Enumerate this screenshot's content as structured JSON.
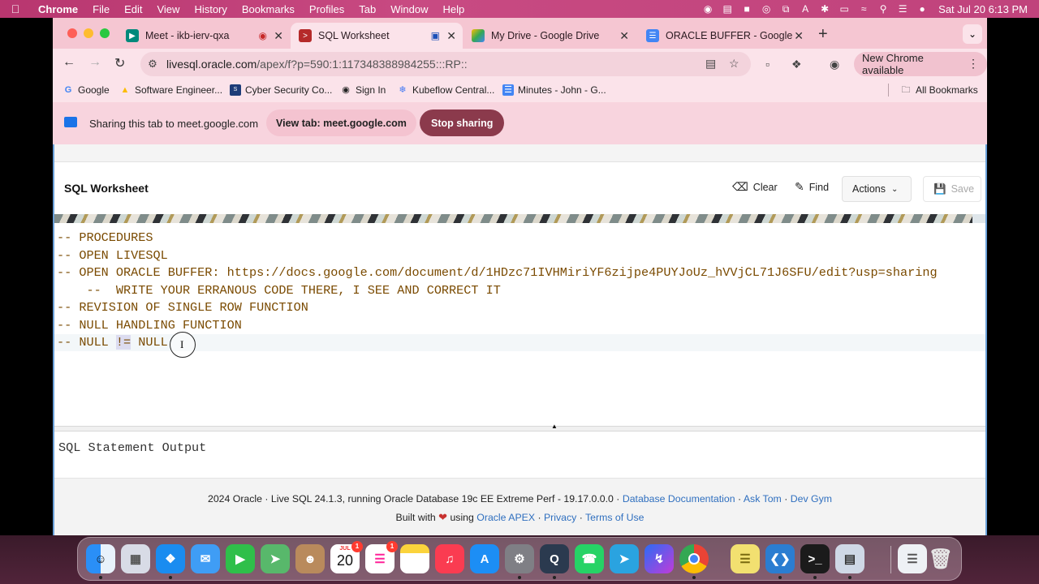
{
  "menubar": {
    "app": "Chrome",
    "items": [
      "File",
      "Edit",
      "View",
      "History",
      "Bookmarks",
      "Profiles",
      "Tab",
      "Window",
      "Help"
    ],
    "clock": "Sat Jul 20  6:13 PM"
  },
  "tabs": [
    {
      "title": "Meet - ikb-ierv-qxa",
      "favicon": "meet-icon"
    },
    {
      "title": "SQL Worksheet",
      "favicon": "terminal-icon"
    },
    {
      "title": "My Drive - Google Drive",
      "favicon": "drive-icon"
    },
    {
      "title": "ORACLE BUFFER - Google Do",
      "favicon": "docs-icon"
    }
  ],
  "address": {
    "host": "livesql.oracle.com",
    "path": "/apex/f?p=590:1:117348388984255:::RP::"
  },
  "new_chrome_label": "New Chrome available",
  "bookmarks": {
    "items": [
      "Google",
      "Software Engineer...",
      "Cyber Security Co...",
      "Sign In",
      "Kubeflow Central...",
      "Minutes - John - G..."
    ],
    "all_label": "All Bookmarks"
  },
  "sharebar": {
    "text": "Sharing this tab to meet.google.com",
    "view_tab": "View tab: meet.google.com",
    "stop": "Stop sharing"
  },
  "worksheet": {
    "title": "SQL Worksheet",
    "clear": "Clear",
    "find": "Find",
    "actions": "Actions",
    "save": "Save"
  },
  "editor": {
    "lines": [
      "-- PROCEDURES",
      "-- OPEN LIVESQL",
      "-- OPEN ORACLE BUFFER: https://docs.google.com/document/d/1HDzc71IVHMiriYF6zijpe4PUYJoUz_hVVjCL71J6SFU/edit?usp=sharing",
      "    --  WRITE YOUR ERRANOUS CODE THERE, I SEE AND CORRECT IT",
      "-- REVISION OF SINGLE ROW FUNCTION",
      "-- NULL HANDLING FUNCTION"
    ],
    "last_line": {
      "before": "-- NULL ",
      "highlight": "!=",
      "after": " NULL"
    }
  },
  "output": {
    "title": "SQL Statement Output"
  },
  "footer": {
    "line1_text": "2024 Oracle · Live SQL 24.1.3, running Oracle Database 19c EE Extreme Perf - 19.17.0.0.0 · ",
    "link_docs": "Database Documentation",
    "sep": " · ",
    "link_asktom": "Ask Tom",
    "link_devgym": "Dev Gym",
    "built_with": "Built with ",
    "using": " using ",
    "link_apex": "Oracle APEX",
    "link_privacy": "Privacy",
    "link_terms": "Terms of Use"
  },
  "dock": {
    "apps": [
      "finder-icon",
      "launchpad-icon",
      "safari-icon",
      "mail-icon",
      "facetime-icon",
      "maps-icon",
      "contacts-icon",
      "calendar-icon",
      "reminders-icon",
      "notes-icon",
      "music-icon",
      "app-store-icon",
      "system-settings-icon",
      "quicktime-icon",
      "whatsapp-icon",
      "telegram-icon",
      "messenger-icon",
      "chrome-icon",
      "stickies-icon",
      "vscode-icon",
      "terminal-icon",
      "preview-icon",
      "document-icon",
      "trash-icon"
    ],
    "calendar_month": "JUL",
    "calendar_day": "20",
    "reminders_badge": "1",
    "calendar_badge": "1"
  },
  "colors": {
    "accent": "#8b3a4c",
    "tabstrip": "#f5c6d2",
    "code": "#7a4a00",
    "link": "#2f6fbf"
  }
}
